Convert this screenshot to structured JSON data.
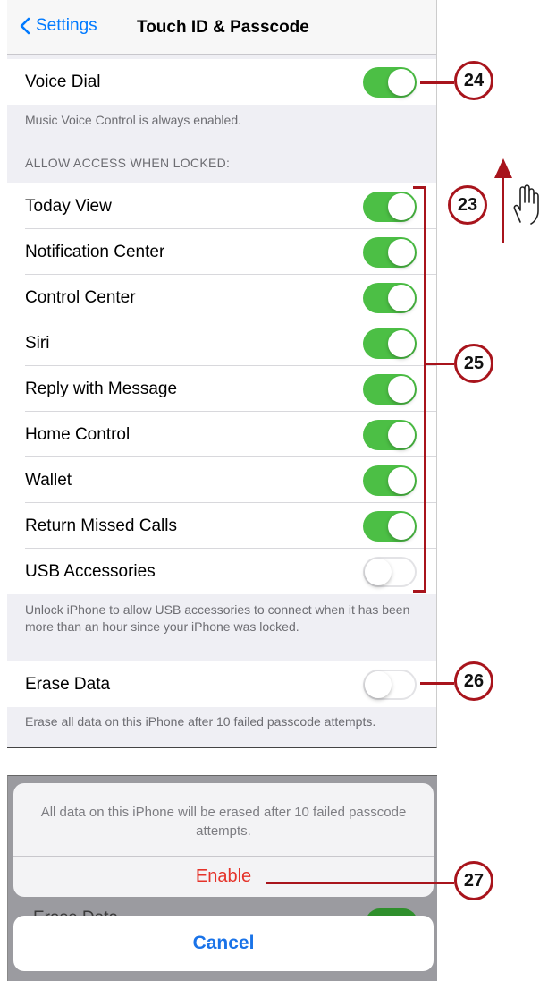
{
  "nav": {
    "back_label": "Settings",
    "title": "Touch ID & Passcode"
  },
  "voice_dial": {
    "label": "Voice Dial",
    "on": true,
    "footnote": "Music Voice Control is always enabled."
  },
  "allow_access_header": "ALLOW ACCESS WHEN LOCKED:",
  "allow_items": [
    {
      "label": "Today View",
      "on": true
    },
    {
      "label": "Notification Center",
      "on": true
    },
    {
      "label": "Control Center",
      "on": true
    },
    {
      "label": "Siri",
      "on": true
    },
    {
      "label": "Reply with Message",
      "on": true
    },
    {
      "label": "Home Control",
      "on": true
    },
    {
      "label": "Wallet",
      "on": true
    },
    {
      "label": "Return Missed Calls",
      "on": true
    },
    {
      "label": "USB Accessories",
      "on": false
    }
  ],
  "usb_footnote": "Unlock iPhone to allow USB accessories to connect when it has been more than an hour since your iPhone was locked.",
  "erase": {
    "label": "Erase Data",
    "on": false,
    "footnote": "Erase all data on this iPhone after 10 failed passcode attempts."
  },
  "alert": {
    "message": "All data on this iPhone will be erased after 10 failed passcode attempts.",
    "enable_label": "Enable",
    "cancel_label": "Cancel",
    "background_label": "Erase Data"
  },
  "callouts": {
    "c23": "23",
    "c24": "24",
    "c25": "25",
    "c26": "26",
    "c27": "27"
  },
  "colors": {
    "toggle_on": "#4cbf45",
    "ios_blue": "#007aff",
    "destructive_red": "#e5332a",
    "callout_red": "#a8141c"
  }
}
